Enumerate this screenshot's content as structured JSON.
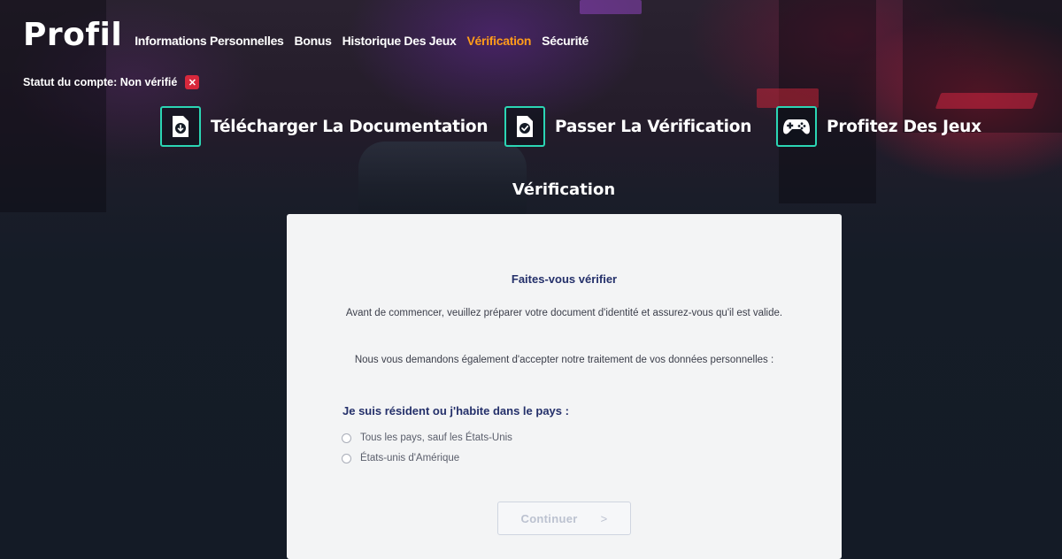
{
  "header": {
    "title": "Profil",
    "nav": [
      {
        "label": "Informations Personnelles",
        "active": false
      },
      {
        "label": "Bonus",
        "active": false
      },
      {
        "label": "Historique Des Jeux",
        "active": false
      },
      {
        "label": "Vérification",
        "active": true
      },
      {
        "label": "Sécurité",
        "active": false
      }
    ],
    "active_color": "#ff9c1a"
  },
  "account_status": {
    "text": "Statut du compte: Non vérifié",
    "badge_icon": "x-icon",
    "badge_color": "#d8283c"
  },
  "steps": [
    {
      "label": "Télécharger La Documentation",
      "icon": "download-document-icon"
    },
    {
      "label": "Passer La Vérification",
      "icon": "check-document-icon"
    },
    {
      "label": "Profitez Des Jeux",
      "icon": "gamepad-icon"
    }
  ],
  "step_accent": "#2bd6b4",
  "section_title": "Vérification",
  "card": {
    "title": "Faites-vous vérifier",
    "paragraph1": "Avant de commencer, veuillez préparer votre document d'identité et assurez-vous qu'il est valide.",
    "paragraph2": "Nous vous demandons également d'accepter notre traitement de vos données personnelles :",
    "question": "Je suis résident ou j'habite dans le pays :",
    "options": [
      {
        "label": "Tous les pays, sauf les États-Unis",
        "selected": false
      },
      {
        "label": "États-unis d'Amérique",
        "selected": false
      }
    ],
    "continue_label": "Continuer",
    "continue_arrow": ">"
  }
}
